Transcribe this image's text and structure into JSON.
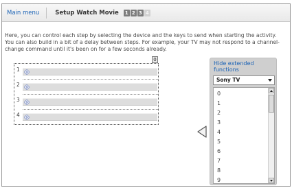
{
  "header": {
    "main_menu": "Main menu",
    "title": "Setup Watch Movie",
    "steps": [
      "1",
      "2",
      "3",
      "4"
    ],
    "current_step": 3
  },
  "description": "Here, you can control each step by selecting the device and the keys to send when starting the activity. You can also build in a bit of a delay between steps. For example, your TV may not respond to a channel-change command until it's been on for a few seconds already.",
  "sequence": {
    "zero_button": "0",
    "rows": [
      {
        "number": "1",
        "icon": "diamond-arrow-icon"
      },
      {
        "number": "2",
        "icon": "diamond-arrow-icon"
      },
      {
        "number": "3",
        "icon": "diamond-arrow-icon"
      },
      {
        "number": "4",
        "icon": "diamond-arrow-icon"
      }
    ]
  },
  "add_arrow_icon": "left-triangle-icon",
  "panel": {
    "hide_link": "Hide extended functions",
    "device": "Sony TV",
    "keys": [
      "0",
      "1",
      "2",
      "3",
      "4",
      "5",
      "6",
      "7",
      "8",
      "9"
    ]
  },
  "colors": {
    "link": "#1a62b5",
    "panel_bg": "#cfcfcf",
    "step_active": "#7d7d7d",
    "step_inactive": "#d2d2d2"
  }
}
